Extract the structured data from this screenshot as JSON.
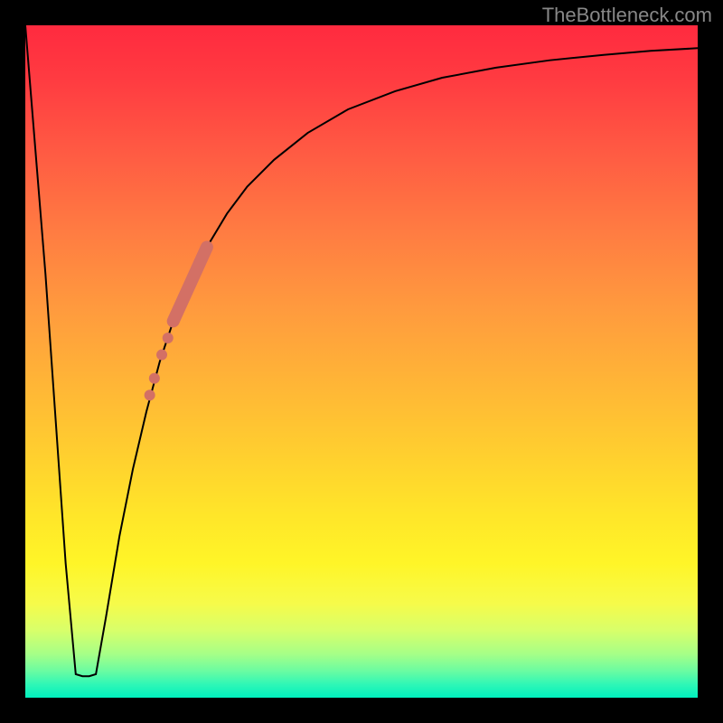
{
  "watermark": "TheBottleneck.com",
  "chart_data": {
    "type": "line",
    "title": "",
    "xlabel": "",
    "ylabel": "",
    "xlim": [
      0,
      100
    ],
    "ylim": [
      0,
      100
    ],
    "x": [
      0,
      3,
      6,
      7.5,
      8.5,
      9.5,
      10.5,
      12,
      14,
      16,
      18,
      20,
      22,
      24,
      27,
      30,
      33,
      37,
      42,
      48,
      55,
      62,
      70,
      78,
      86,
      93,
      100
    ],
    "values": [
      100,
      63,
      20,
      3.5,
      3.2,
      3.2,
      3.5,
      12,
      24,
      34,
      42.5,
      50,
      56,
      61,
      67,
      72,
      76,
      80,
      84,
      87.5,
      90.2,
      92.2,
      93.7,
      94.8,
      95.6,
      96.2,
      96.6
    ],
    "curve_color": "#000000",
    "curve_width": 2,
    "highlight_points": {
      "color": "#d37065",
      "points": [
        {
          "x": 18.5,
          "y": 45,
          "r": 6
        },
        {
          "x": 19.2,
          "y": 47.5,
          "r": 6
        },
        {
          "x": 20.3,
          "y": 51,
          "r": 6
        },
        {
          "x": 21.2,
          "y": 53.5,
          "r": 6
        }
      ],
      "thick_segment": {
        "x0": 22,
        "y0": 56,
        "x1": 27,
        "y1": 67,
        "width": 14
      }
    },
    "gradient_stops": [
      {
        "pos": 0.0,
        "color": "#ff2a3f"
      },
      {
        "pos": 0.08,
        "color": "#ff3b41"
      },
      {
        "pos": 0.18,
        "color": "#ff5843"
      },
      {
        "pos": 0.3,
        "color": "#ff7a42"
      },
      {
        "pos": 0.42,
        "color": "#ff9a3e"
      },
      {
        "pos": 0.54,
        "color": "#ffb736"
      },
      {
        "pos": 0.65,
        "color": "#ffd22e"
      },
      {
        "pos": 0.73,
        "color": "#ffe629"
      },
      {
        "pos": 0.8,
        "color": "#fff528"
      },
      {
        "pos": 0.86,
        "color": "#f6fb4a"
      },
      {
        "pos": 0.9,
        "color": "#d8ff6a"
      },
      {
        "pos": 0.935,
        "color": "#a6ff87"
      },
      {
        "pos": 0.96,
        "color": "#6bfca1"
      },
      {
        "pos": 0.98,
        "color": "#2ff7b6"
      },
      {
        "pos": 1.0,
        "color": "#00f0be"
      }
    ]
  }
}
